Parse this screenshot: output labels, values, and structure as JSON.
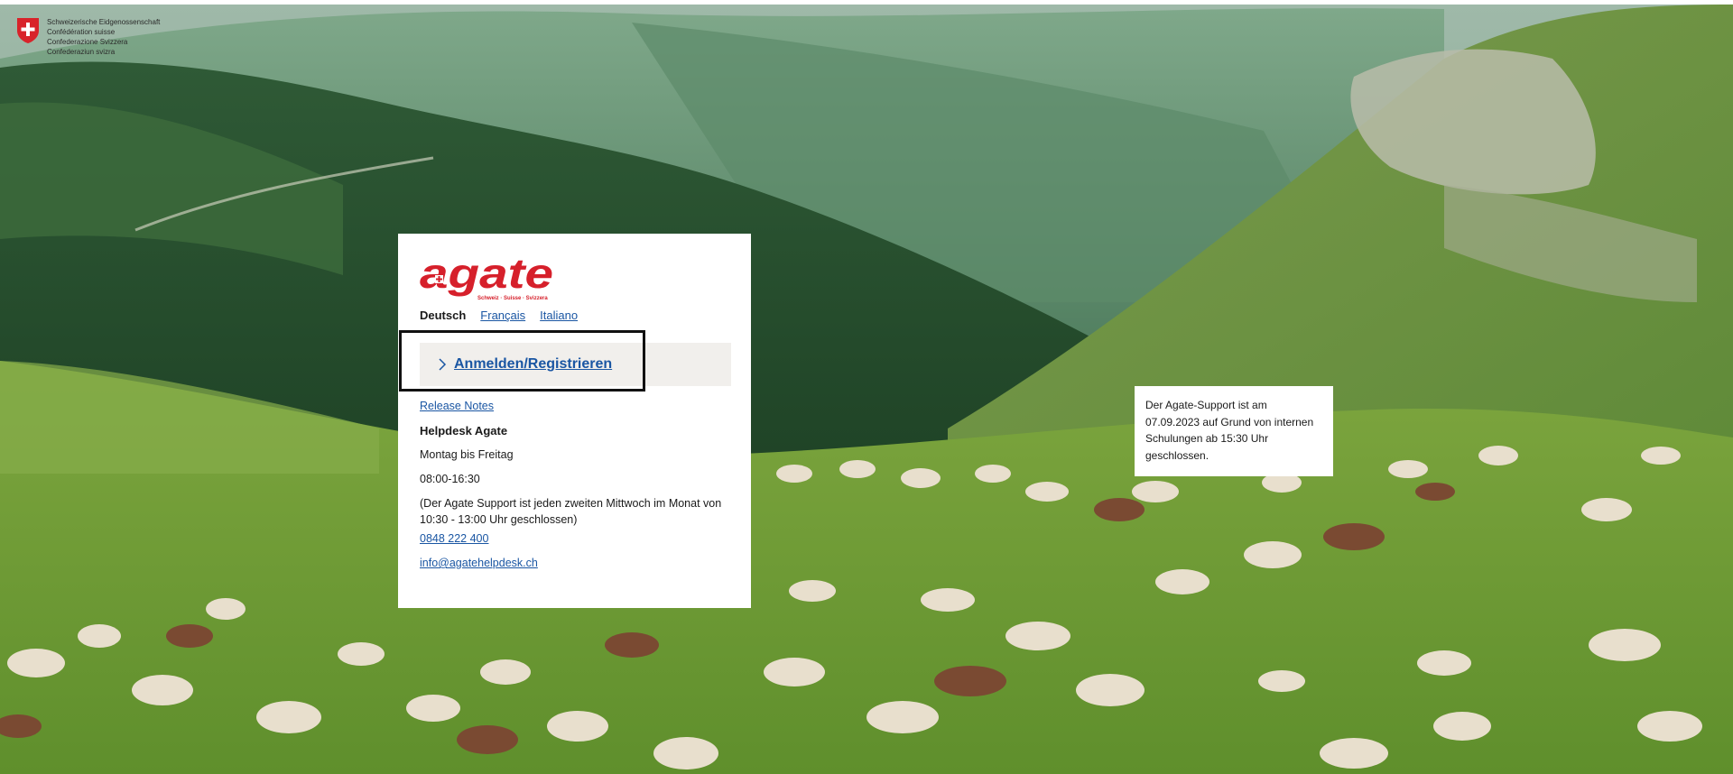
{
  "confederation": {
    "lines": [
      "Schweizerische Eidgenossenschaft",
      "Confédération suisse",
      "Confederazione Svizzera",
      "Confederaziun svizra"
    ]
  },
  "brand": {
    "name": "agate",
    "tagline": "Schweiz · Suisse · Svizzera",
    "accent_color": "#d6202b",
    "gray_color": "#4d4d4d"
  },
  "languages": {
    "active": "Deutsch",
    "options": [
      "Français",
      "Italiano"
    ]
  },
  "login": {
    "label": "Anmelden/Registrieren",
    "icon": "chevron-right-icon"
  },
  "links": {
    "release_notes": "Release Notes",
    "phone": "0848 222 400",
    "email": "info@agatehelpdesk.ch"
  },
  "helpdesk": {
    "title": "Helpdesk Agate",
    "days": "Montag bis Freitag",
    "hours": "08:00-16:30",
    "note": "(Der Agate Support ist jeden zweiten Mittwoch im Monat von 10:30 - 13:00 Uhr geschlossen)"
  },
  "notice": {
    "text": "Der Agate-Support ist am 07.09.2023 auf Grund von internen Schulungen ab 15:30 Uhr geschlossen."
  }
}
